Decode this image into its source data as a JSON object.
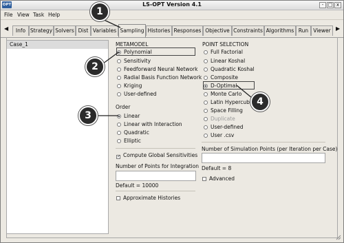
{
  "window": {
    "icon_text": "OPT",
    "title": "LS-OPT Version 4.1",
    "buttons": [
      "-",
      "□",
      "x"
    ]
  },
  "menu": [
    "File",
    "View",
    "Task",
    "Help"
  ],
  "tabs": [
    "Info",
    "Strategy",
    "Solvers",
    "Dist",
    "Variables",
    "Sampling",
    "Histories",
    "Responses",
    "Objective",
    "Constraints",
    "Algorithms",
    "Run",
    "Viewer"
  ],
  "active_tab": "Sampling",
  "cases": [
    "Case_1"
  ],
  "metamodel": {
    "header": "METAMODEL",
    "options": [
      "Polynomial",
      "Sensitivity",
      "Feedforward Neural Network",
      "Radial Basis Function Network",
      "Kriging",
      "User-defined"
    ],
    "selected": "Polynomial"
  },
  "order": {
    "header": "Order",
    "options": [
      "Linear",
      "Linear with Interaction",
      "Quadratic",
      "Elliptic"
    ],
    "selected": "Linear"
  },
  "global_sens": {
    "label": "Compute Global Sensitivities",
    "checked": true
  },
  "integration": {
    "label": "Number of Points for Integration",
    "value": "",
    "default_text": "Default = 10000"
  },
  "approx_histories": {
    "label": "Approximate Histories",
    "checked": false
  },
  "point_selection": {
    "header": "POINT SELECTION",
    "options": [
      "Full Factorial",
      "Linear Koshal",
      "Quadratic Koshal",
      "Composite",
      "D-Optimal",
      "Monte Carlo",
      "Latin Hypercube",
      "Space Filling",
      "Duplicate",
      "User-defined",
      "User .csv"
    ],
    "selected": "D-Optimal",
    "disabled": [
      "Duplicate"
    ]
  },
  "sim_points": {
    "label": "Number of Simulation Points (per Iteration per Case)",
    "value": "",
    "default_text": "Default = 8"
  },
  "advanced": {
    "label": "Advanced",
    "checked": false
  },
  "callouts": [
    "1",
    "2",
    "3",
    "4"
  ],
  "colors": {
    "window_bg": "#ece9e2",
    "callout_bg": "#2b2b2b"
  }
}
